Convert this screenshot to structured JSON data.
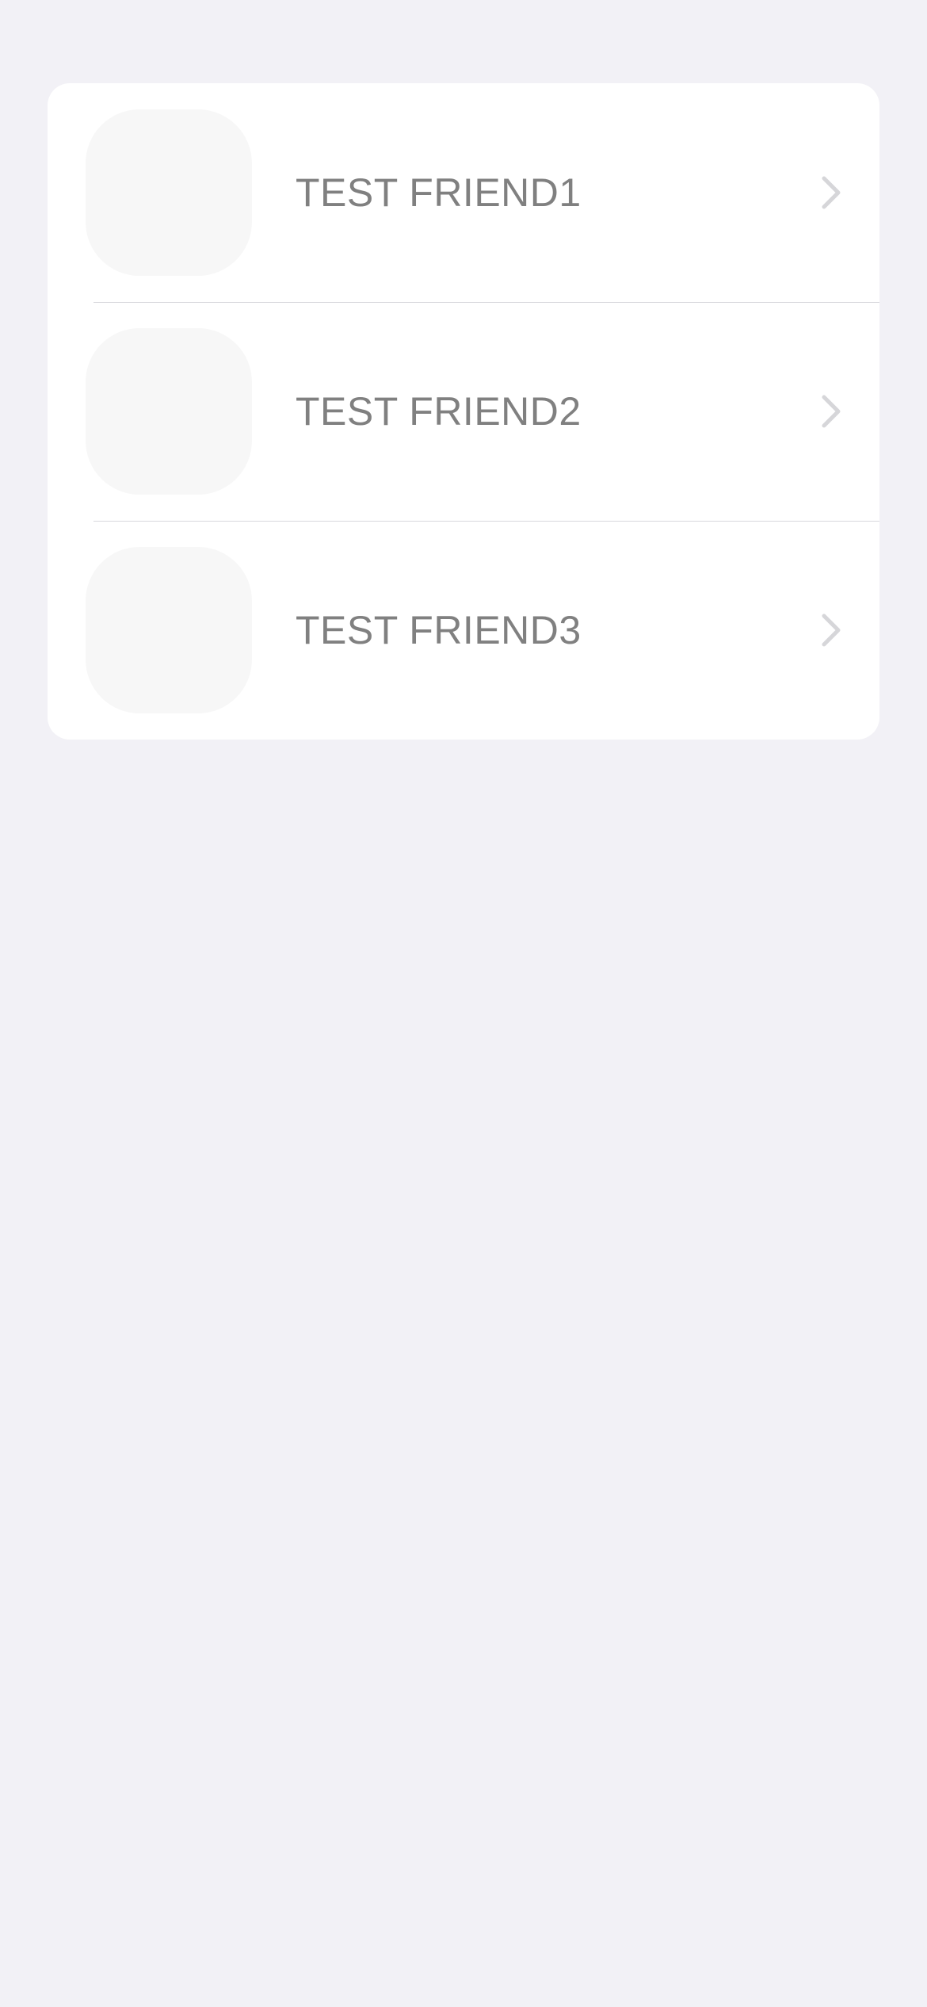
{
  "friends": [
    {
      "name": "TEST FRIEND1",
      "avatar_icon": "avatar-placeholder",
      "chevron_icon": "chevron-right-icon"
    },
    {
      "name": "TEST FRIEND2",
      "avatar_icon": "avatar-placeholder",
      "chevron_icon": "chevron-right-icon"
    },
    {
      "name": "TEST FRIEND3",
      "avatar_icon": "avatar-placeholder",
      "chevron_icon": "chevron-right-icon"
    }
  ],
  "colors": {
    "background": "#f2f1f6",
    "card": "#ffffff",
    "text": "#808080",
    "avatar_placeholder": "#f7f7f7",
    "chevron": "#d6d6d9",
    "separator": "#d8d8dc"
  }
}
